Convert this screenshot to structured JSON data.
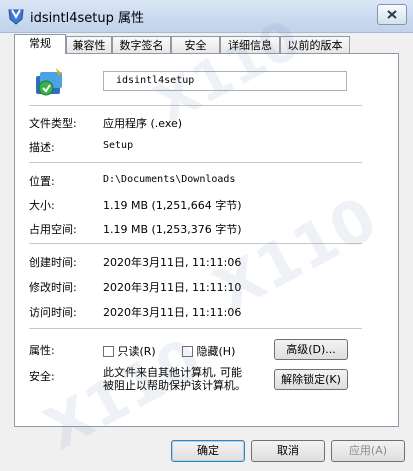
{
  "window": {
    "title": "idsintl4setup 属性",
    "close_icon": "close-icon"
  },
  "tabs": [
    {
      "label": "常规"
    },
    {
      "label": "兼容性"
    },
    {
      "label": "数字签名"
    },
    {
      "label": "安全"
    },
    {
      "label": "详细信息"
    },
    {
      "label": "以前的版本"
    }
  ],
  "general": {
    "file_name": "idsintl4setup",
    "file_type_label": "文件类型:",
    "file_type_value": "应用程序 (.exe)",
    "description_label": "描述:",
    "description_value": "Setup",
    "location_label": "位置:",
    "location_value": "D:\\Documents\\Downloads",
    "size_label": "大小:",
    "size_value": "1.19 MB (1,251,664 字节)",
    "size_on_disk_label": "占用空间:",
    "size_on_disk_value": "1.19 MB (1,253,376 字节)",
    "created_label": "创建时间:",
    "created_value": "2020年3月11日, 11:11:06",
    "modified_label": "修改时间:",
    "modified_value": "2020年3月11日, 11:11:10",
    "accessed_label": "访问时间:",
    "accessed_value": "2020年3月11日, 11:11:06",
    "attributes_label": "属性:",
    "readonly_label": "只读(R)",
    "hidden_label": "隐藏(H)",
    "advanced_button": "高级(D)...",
    "security_label": "安全:",
    "security_text_line1": "此文件来自其他计算机, 可能",
    "security_text_line2": "被阻止以帮助保护该计算机。",
    "unblock_button": "解除锁定(K)"
  },
  "footer": {
    "ok": "确定",
    "cancel": "取消",
    "apply": "应用(A)"
  },
  "watermark": {
    "text": "X110"
  },
  "colors": {
    "titlebar": "#c9d9ee",
    "panel": "#ffffff",
    "dialog": "#f0f0f0"
  }
}
